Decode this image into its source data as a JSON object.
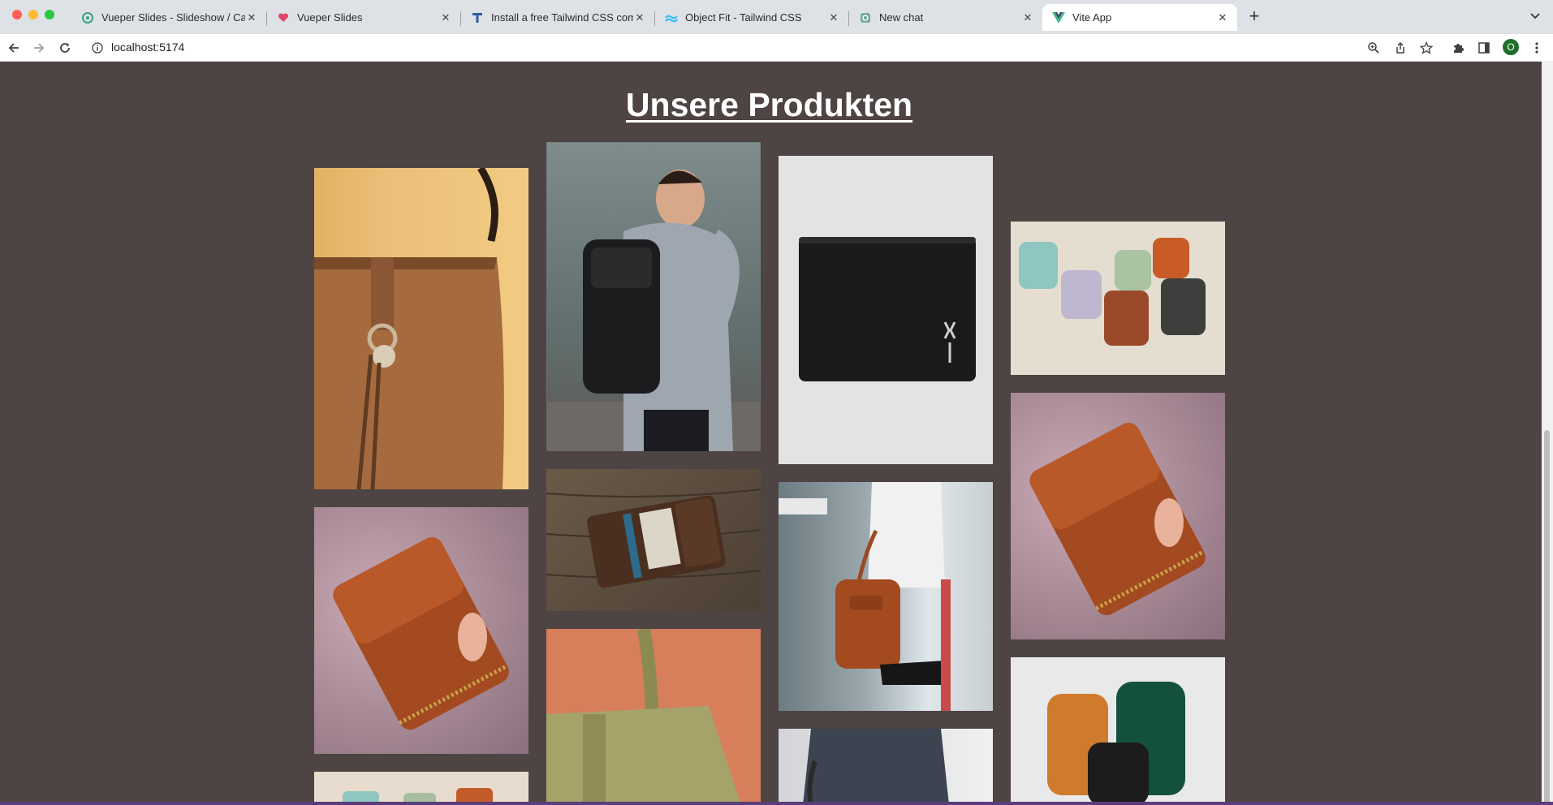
{
  "browser": {
    "tabs": [
      {
        "title": "Vueper Slides - Slideshow / Ca",
        "favicon": "vueper-icon",
        "active": false
      },
      {
        "title": "Vueper Slides",
        "favicon": "vueper-heart-icon",
        "active": false
      },
      {
        "title": "Install a free Tailwind CSS com",
        "favicon": "tailwind-t-icon",
        "active": false
      },
      {
        "title": "Object Fit - Tailwind CSS",
        "favicon": "tailwind-wave-icon",
        "active": false
      },
      {
        "title": "New chat",
        "favicon": "chat-icon",
        "active": false
      },
      {
        "title": "Vite App",
        "favicon": "vue-icon",
        "active": true
      }
    ],
    "address": "localhost:5174",
    "profile_initial": "O"
  },
  "page": {
    "title": "Unsere Produkten",
    "background": "#4e4444",
    "products": [
      {
        "name": "Tan leather tote bag with ring charm"
      },
      {
        "name": "Man wearing black roll-top backpack"
      },
      {
        "name": "Black leather bifold wallet with stag emblem"
      },
      {
        "name": "Group of pastel school backpacks"
      },
      {
        "name": "Red-brown leather zip wallet held in hand"
      },
      {
        "name": "Dark brown leather card wallet on wooden table"
      },
      {
        "name": "Woman carrying red leather mini backpack"
      },
      {
        "name": "Red-brown leather zip wallet held in hand"
      },
      {
        "name": "Green pebbled leather tote"
      },
      {
        "name": "Pastel school backpacks"
      },
      {
        "name": "Person in denim with shoulder bag"
      },
      {
        "name": "Orange, green and black backpacks"
      }
    ]
  }
}
